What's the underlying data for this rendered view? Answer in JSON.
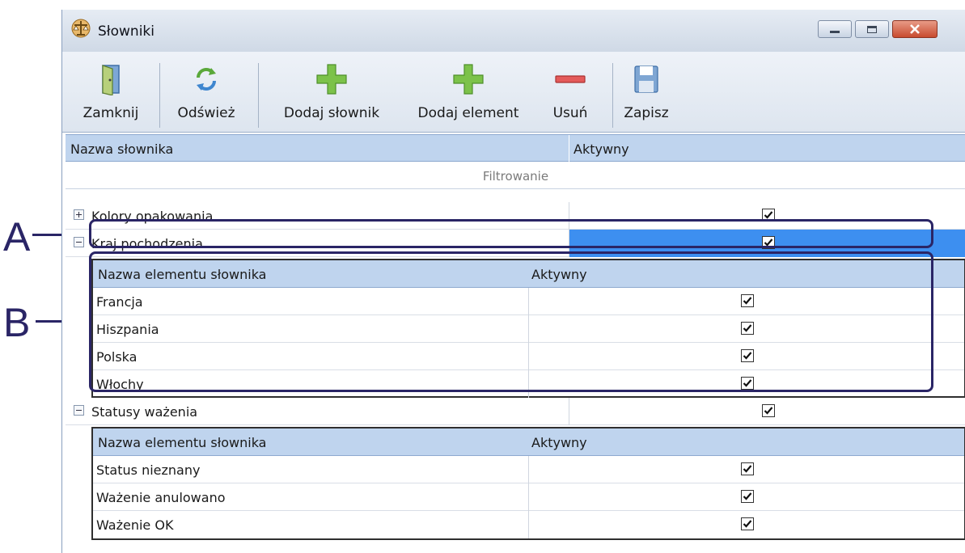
{
  "window": {
    "title": "Słowniki"
  },
  "toolbar": {
    "buttons": [
      {
        "label": "Zamknij",
        "icon": "door-icon"
      },
      {
        "label": "Odśwież",
        "icon": "refresh-icon"
      },
      {
        "label": "Dodaj słownik",
        "icon": "plus-icon"
      },
      {
        "label": "Dodaj element",
        "icon": "plus-icon"
      },
      {
        "label": "Usuń",
        "icon": "minus-icon"
      },
      {
        "label": "Zapisz",
        "icon": "save-icon"
      }
    ]
  },
  "grid": {
    "columns": [
      "Nazwa słownika",
      "Aktywny"
    ],
    "filter_text": "Filtrowanie",
    "dictionaries": [
      {
        "name": "Kolory opakowania",
        "active": true,
        "expanded": false
      },
      {
        "name": "Kraj pochodzenia",
        "active": true,
        "expanded": true,
        "selected": true
      },
      {
        "name": "Statusy ważenia",
        "active": true,
        "expanded": true
      }
    ],
    "detail_columns": [
      "Nazwa elementu słownika",
      "Aktywny"
    ],
    "kraj_items": [
      {
        "name": "Francja",
        "active": true
      },
      {
        "name": "Hiszpania",
        "active": true
      },
      {
        "name": "Polska",
        "active": true
      },
      {
        "name": "Włochy",
        "active": true
      }
    ],
    "status_items": [
      {
        "name": "Status nieznany",
        "active": true
      },
      {
        "name": "Ważenie anulowano",
        "active": true
      },
      {
        "name": "Ważenie OK",
        "active": true
      }
    ]
  },
  "callouts": {
    "a": "A",
    "b": "B"
  },
  "colors": {
    "selection": "#3d8ff0",
    "callout": "#2a2566",
    "header": "#bfd4ee"
  }
}
